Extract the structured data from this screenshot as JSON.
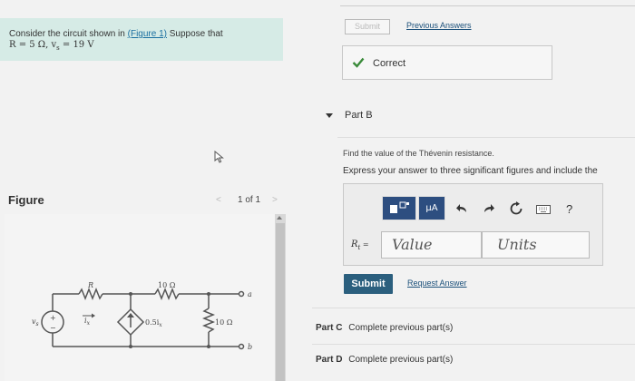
{
  "problem": {
    "intro": "Consider the circuit shown in",
    "figure_link": "(Figure 1)",
    "suppose": "Suppose that",
    "givens": "R = 5 Ω, v",
    "givens_sub": "s",
    "givens_end": " = 19 V"
  },
  "figure": {
    "label": "Figure",
    "pager_prev": "<",
    "pager_text": "1 of 1",
    "pager_next": ">",
    "circuit": {
      "r_label": "R",
      "r1_label": "10 Ω",
      "r2_label": "10 Ω",
      "dep_source_label": "0.5i",
      "dep_source_sub": "x",
      "current_label": "i",
      "current_sub": "x",
      "voltage_label": "v",
      "voltage_sub": "s",
      "node_a": "a",
      "node_b": "b",
      "plus": "+",
      "minus": "−"
    }
  },
  "part_a": {
    "submit_label": "Submit",
    "previous_answers": "Previous Answers",
    "status": "Correct"
  },
  "part_b": {
    "label": "Part B",
    "instruction1": "Find the value of the Thévenin resistance.",
    "instruction2": "Express your answer to three significant figures and include the",
    "toolbar": {
      "mu_label": "μA",
      "help": "?"
    },
    "answer_label": "R",
    "answer_label_sub": "t",
    "answer_label_eq": " =",
    "value_placeholder": "Value",
    "units_placeholder": "Units",
    "submit_label": "Submit",
    "request_answer": "Request Answer"
  },
  "other_parts": [
    {
      "label": "Part C",
      "status": "Complete previous part(s)"
    },
    {
      "label": "Part D",
      "status": "Complete previous part(s)"
    }
  ],
  "colors": {
    "problem_bg": "#d6ebe6",
    "link": "#1a4f7a",
    "submit_bg": "#2b5f7e",
    "toolbar_bg": "#2d4e80",
    "correct_check": "#3a8a3a"
  }
}
